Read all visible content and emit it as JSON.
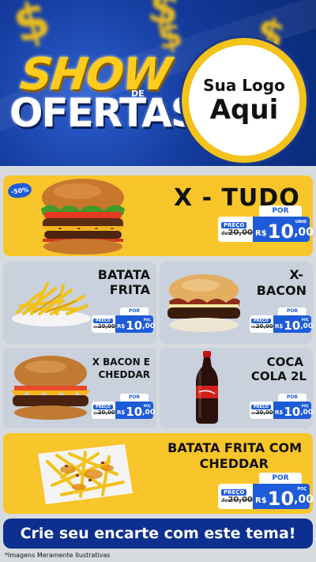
{
  "header": {
    "show_word": "SHOW",
    "de_word": "DE",
    "ofertas_word": "OFERTAS",
    "logo_line1": "Sua Logo",
    "logo_line2": "Aqui",
    "dollar_symbol": "$"
  },
  "colors": {
    "yellow": "#f8c52a",
    "blue": "#1e5bd8",
    "navy": "#0d2f8f",
    "gray_card": "#c9d1dc"
  },
  "badge": "-50%",
  "price_common": {
    "preco": "PREÇO",
    "por": "POR",
    "unid": "UNID",
    "poc": "POÇ",
    "currency": "R$",
    "old_prefix": "de",
    "old_value": "20,00",
    "new_int": "10",
    "new_dec": ",00"
  },
  "products": [
    {
      "name": "X - TUDO",
      "icon": "burger-image"
    },
    {
      "name_line1": "BATATA",
      "name_line2": "FRITA",
      "icon": "fries-image"
    },
    {
      "name_line1": "X-",
      "name_line2": "BACON",
      "icon": "bacon-burger-image"
    },
    {
      "name_line1": "X BACON E",
      "name_line2": "CHEDDAR",
      "icon": "cheddar-burger-image"
    },
    {
      "name_line1": "COCA",
      "name_line2": "COLA 2L",
      "icon": "soda-bottle-image"
    },
    {
      "name_line1": "BATATA FRITA COM",
      "name_line2": "CHEDDAR",
      "icon": "cheddar-fries-image"
    }
  ],
  "cta": "Crie seu encarte com este tema!",
  "disclaimer": "*Imagens Meramente Ilustrativas"
}
